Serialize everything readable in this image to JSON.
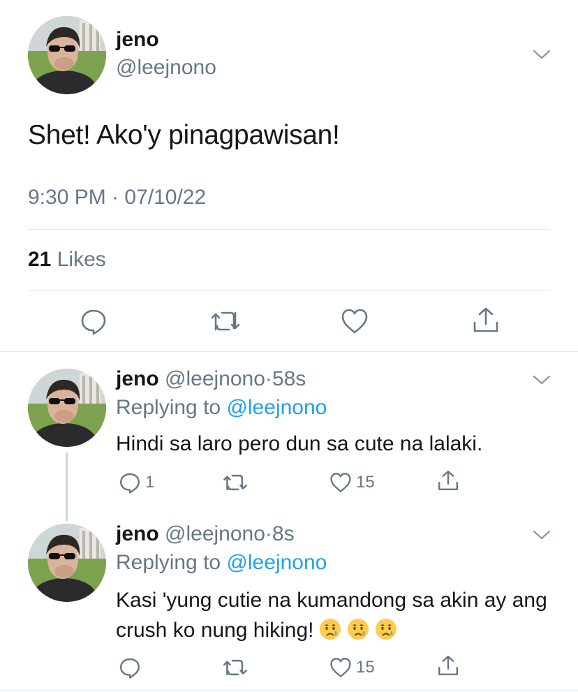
{
  "main_tweet": {
    "name": "jeno",
    "handle": "@leejnono",
    "text": "Shet! Ako'y pinagpawisan!",
    "timestamp": "9:30 PM · 07/10/22",
    "likes_count": "21",
    "likes_label": "Likes",
    "actions": [
      "reply-icon",
      "retweet-icon",
      "like-icon",
      "share-icon"
    ]
  },
  "replies": [
    {
      "name": "jeno",
      "handle": "@leejnono",
      "separator": "·",
      "time": "58s",
      "replying_prefix": "Replying to",
      "replying_to": "@leejnono",
      "text": "Hindi sa laro pero dun sa cute na lalaki.",
      "reply_count": "1",
      "retweet_count": "",
      "like_count": "15"
    },
    {
      "name": "jeno",
      "handle": "@leejnono",
      "separator": "·",
      "time": "8s",
      "replying_prefix": "Replying to",
      "replying_to": "@leejnono",
      "text": "Kasi 'yung cutie na kumandong sa akin ay ang crush ko nung hiking!",
      "emojis": [
        "crying-face-icon",
        "crying-face-icon",
        "crying-face-icon"
      ],
      "reply_count": "",
      "retweet_count": "",
      "like_count": "15"
    }
  ],
  "colors": {
    "text": "#14171a",
    "secondary": "#657786",
    "link": "#1da1f2",
    "divider": "#e1e8ed"
  }
}
